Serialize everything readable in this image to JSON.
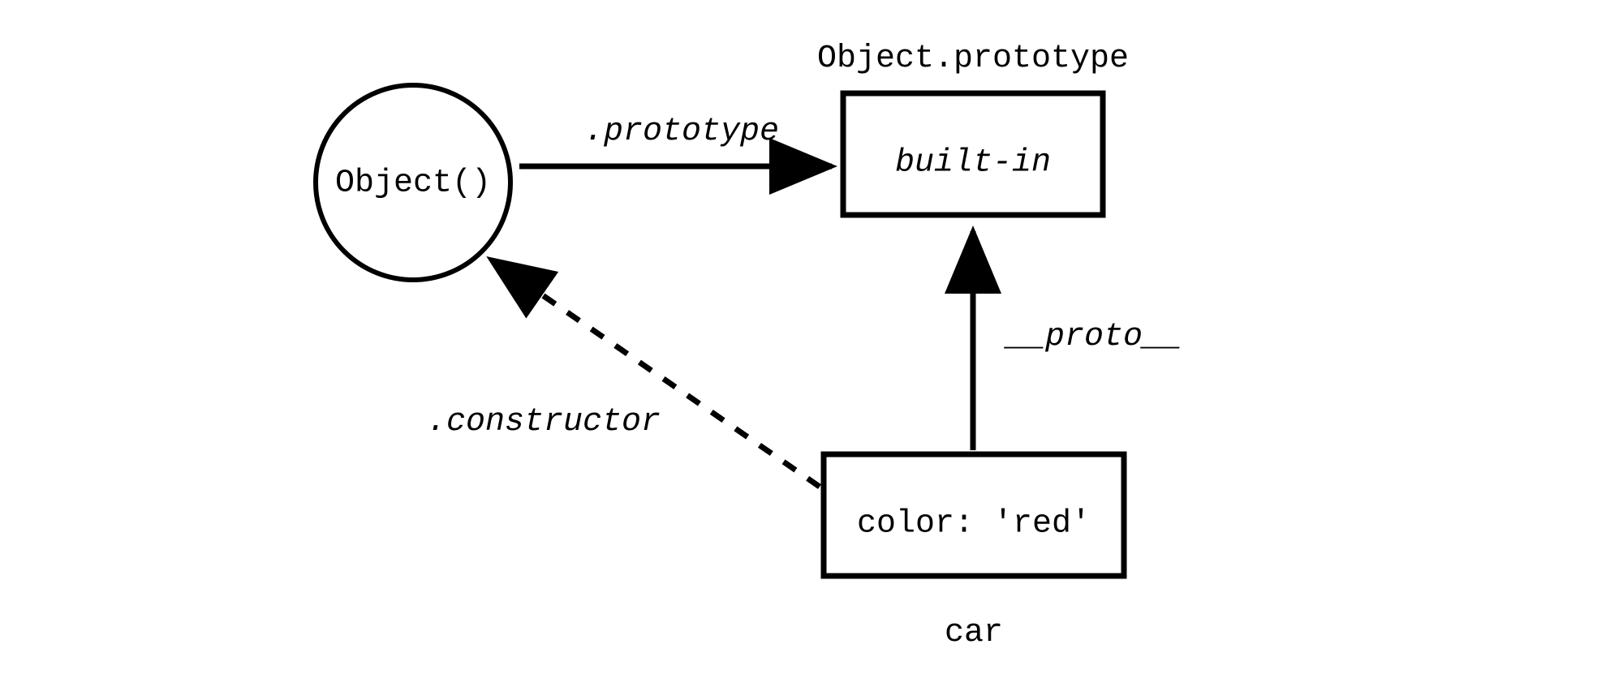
{
  "nodes": {
    "object_fn": {
      "label": "Object()"
    },
    "object_prototype": {
      "title": "Object.prototype",
      "content": "built-in"
    },
    "car": {
      "content": "color: 'red'",
      "title": "car"
    }
  },
  "edges": {
    "prototype": {
      "label": ".prototype"
    },
    "proto": {
      "label": "__proto__"
    },
    "constructor": {
      "label": ".constructor"
    }
  }
}
